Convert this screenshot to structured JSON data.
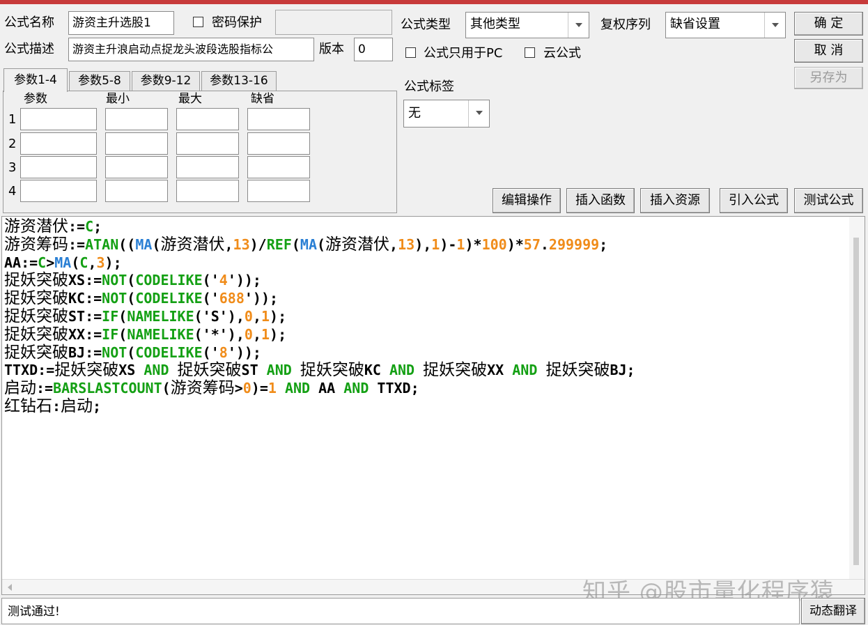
{
  "formula": {
    "name_label": "公式名称",
    "name_value": "游资主升选股1",
    "password_label": "密码保护",
    "desc_label": "公式描述",
    "desc_value": "游资主升浪启动点捉龙头波段选股指标公",
    "version_label": "版本",
    "version_value": "0",
    "type_label": "公式类型",
    "type_value": "其他类型",
    "restore_label": "复权序列",
    "restore_value": "缺省设置",
    "pc_only_label": "公式只用于PC",
    "cloud_label": "云公式",
    "tag_label": "公式标签",
    "tag_value": "无"
  },
  "buttons": {
    "ok": "确  定",
    "cancel": "取  消",
    "save_as": "另存为",
    "edit_ops": "编辑操作",
    "insert_func": "插入函数",
    "insert_resource": "插入资源",
    "import_formula": "引入公式",
    "test_formula": "测试公式",
    "dynamic_translate": "动态翻译"
  },
  "tabs": [
    "参数1-4",
    "参数5-8",
    "参数9-12",
    "参数13-16"
  ],
  "params": {
    "headers": [
      "参数",
      "最小",
      "最大",
      "缺省"
    ],
    "rows": [
      "1",
      "2",
      "3",
      "4"
    ]
  },
  "code_lines": [
    [
      [
        "cn",
        "游资潜伏"
      ],
      [
        "t",
        ":="
      ],
      [
        "kw",
        "C"
      ],
      [
        "t",
        ";"
      ]
    ],
    [
      [
        "cn",
        "游资筹码"
      ],
      [
        "t",
        ":="
      ],
      [
        "kw",
        "ATAN"
      ],
      [
        "t",
        "(("
      ],
      [
        "fn",
        "MA"
      ],
      [
        "t",
        "("
      ],
      [
        "cn",
        "游资潜伏"
      ],
      [
        "t",
        ","
      ],
      [
        "num",
        "13"
      ],
      [
        "t",
        ")/"
      ],
      [
        "kw",
        "REF"
      ],
      [
        "t",
        "("
      ],
      [
        "fn",
        "MA"
      ],
      [
        "t",
        "("
      ],
      [
        "cn",
        "游资潜伏"
      ],
      [
        "t",
        ","
      ],
      [
        "num",
        "13"
      ],
      [
        "t",
        "),"
      ],
      [
        "num",
        "1"
      ],
      [
        "t",
        ")-"
      ],
      [
        "num",
        "1"
      ],
      [
        "t",
        ")*"
      ],
      [
        "num",
        "100"
      ],
      [
        "t",
        ")*"
      ],
      [
        "num",
        "57"
      ],
      [
        "t",
        "."
      ],
      [
        "num",
        "299999"
      ],
      [
        "t",
        ";"
      ]
    ],
    [
      [
        "t",
        "AA:="
      ],
      [
        "kw",
        "C"
      ],
      [
        "t",
        ">"
      ],
      [
        "fn",
        "MA"
      ],
      [
        "t",
        "("
      ],
      [
        "kw",
        "C"
      ],
      [
        "t",
        ","
      ],
      [
        "num",
        "3"
      ],
      [
        "t",
        ");"
      ]
    ],
    [
      [
        "cn",
        "捉妖突破"
      ],
      [
        "t",
        "XS:="
      ],
      [
        "kw",
        "NOT"
      ],
      [
        "t",
        "("
      ],
      [
        "kw",
        "CODELIKE"
      ],
      [
        "t",
        "('"
      ],
      [
        "num",
        "4"
      ],
      [
        "t",
        "'));"
      ]
    ],
    [
      [
        "cn",
        "捉妖突破"
      ],
      [
        "t",
        "KC:="
      ],
      [
        "kw",
        "NOT"
      ],
      [
        "t",
        "("
      ],
      [
        "kw",
        "CODELIKE"
      ],
      [
        "t",
        "('"
      ],
      [
        "num",
        "688"
      ],
      [
        "t",
        "'));"
      ]
    ],
    [
      [
        "cn",
        "捉妖突破"
      ],
      [
        "t",
        "ST:="
      ],
      [
        "kw",
        "IF"
      ],
      [
        "t",
        "("
      ],
      [
        "kw",
        "NAMELIKE"
      ],
      [
        "t",
        "('S'),"
      ],
      [
        "num",
        "0"
      ],
      [
        "t",
        ","
      ],
      [
        "num",
        "1"
      ],
      [
        "t",
        ");"
      ]
    ],
    [
      [
        "cn",
        "捉妖突破"
      ],
      [
        "t",
        "XX:="
      ],
      [
        "kw",
        "IF"
      ],
      [
        "t",
        "("
      ],
      [
        "kw",
        "NAMELIKE"
      ],
      [
        "t",
        "('*'),"
      ],
      [
        "num",
        "0"
      ],
      [
        "t",
        ","
      ],
      [
        "num",
        "1"
      ],
      [
        "t",
        ");"
      ]
    ],
    [
      [
        "cn",
        "捉妖突破"
      ],
      [
        "t",
        "BJ:="
      ],
      [
        "kw",
        "NOT"
      ],
      [
        "t",
        "("
      ],
      [
        "kw",
        "CODELIKE"
      ],
      [
        "t",
        "('"
      ],
      [
        "num",
        "8"
      ],
      [
        "t",
        "'));"
      ]
    ],
    [
      [
        "t",
        "TTXD:="
      ],
      [
        "cn",
        "捉妖突破"
      ],
      [
        "t",
        "XS "
      ],
      [
        "kw",
        "AND"
      ],
      [
        "t",
        " "
      ],
      [
        "cn",
        "捉妖突破"
      ],
      [
        "t",
        "ST "
      ],
      [
        "kw",
        "AND"
      ],
      [
        "t",
        " "
      ],
      [
        "cn",
        "捉妖突破"
      ],
      [
        "t",
        "KC "
      ],
      [
        "kw",
        "AND"
      ],
      [
        "t",
        " "
      ],
      [
        "cn",
        "捉妖突破"
      ],
      [
        "t",
        "XX "
      ],
      [
        "kw",
        "AND"
      ],
      [
        "t",
        " "
      ],
      [
        "cn",
        "捉妖突破"
      ],
      [
        "t",
        "BJ;"
      ]
    ],
    [
      [
        "cn",
        "启动"
      ],
      [
        "t",
        ":="
      ],
      [
        "kw",
        "BARSLASTCOUNT"
      ],
      [
        "t",
        "("
      ],
      [
        "cn",
        "游资筹码"
      ],
      [
        "t",
        ">"
      ],
      [
        "num",
        "0"
      ],
      [
        "t",
        ")="
      ],
      [
        "num",
        "1"
      ],
      [
        "t",
        " "
      ],
      [
        "kw",
        "AND"
      ],
      [
        "t",
        " AA "
      ],
      [
        "kw",
        "AND"
      ],
      [
        "t",
        " TTXD;"
      ]
    ],
    [
      [
        "cn",
        "红钻石"
      ],
      [
        "t",
        ":"
      ],
      [
        "cn",
        "启动"
      ],
      [
        "t",
        ";"
      ]
    ]
  ],
  "status_text": "测试通过!",
  "watermark": "知乎 @股市量化程序猿",
  "colors": {
    "keyword": "#14a014",
    "function": "#2a7fd4",
    "number": "#f08c1a",
    "title_bar": "#c73a3a"
  }
}
